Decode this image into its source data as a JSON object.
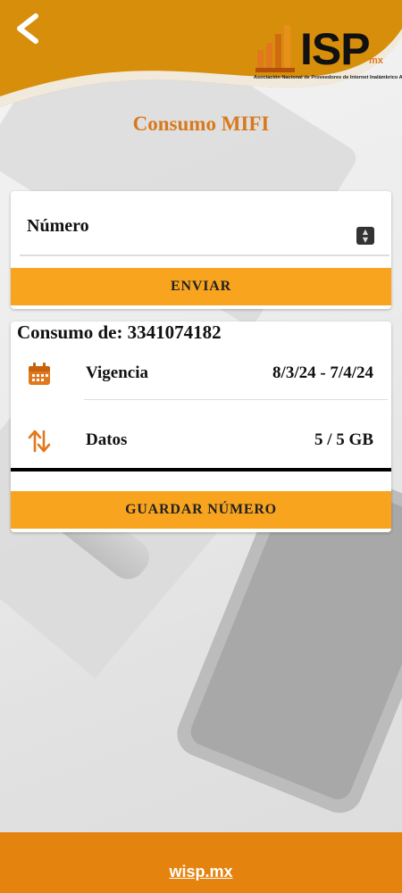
{
  "header": {
    "back_icon": "chevron-left-icon",
    "logo": {
      "text": "ISP",
      "suffix": "mx",
      "subtitle": "Asociación Nacional de Proveedores de Internet Inalámbrico A.C."
    },
    "accent_color": "#e0960e"
  },
  "page": {
    "title": "Consumo MIFI"
  },
  "numero_card": {
    "label": "Número",
    "stepper_icon": "up-down-stepper-icon",
    "send_button": "ENVIAR"
  },
  "consumo_card": {
    "title": "Consumo de: 3341074182",
    "rows": [
      {
        "icon": "calendar-icon",
        "label": "Vigencia",
        "value": "8/3/24 - 7/4/24"
      },
      {
        "icon": "up-down-arrows-icon",
        "label": "Datos",
        "value": "5 / 5 GB"
      }
    ],
    "save_button": "GUARDAR NÚMERO"
  },
  "footer": {
    "link": "wisp.mx",
    "color": "#e5830f"
  },
  "colors": {
    "title": "#d9791d",
    "button": "#f8a41f"
  }
}
